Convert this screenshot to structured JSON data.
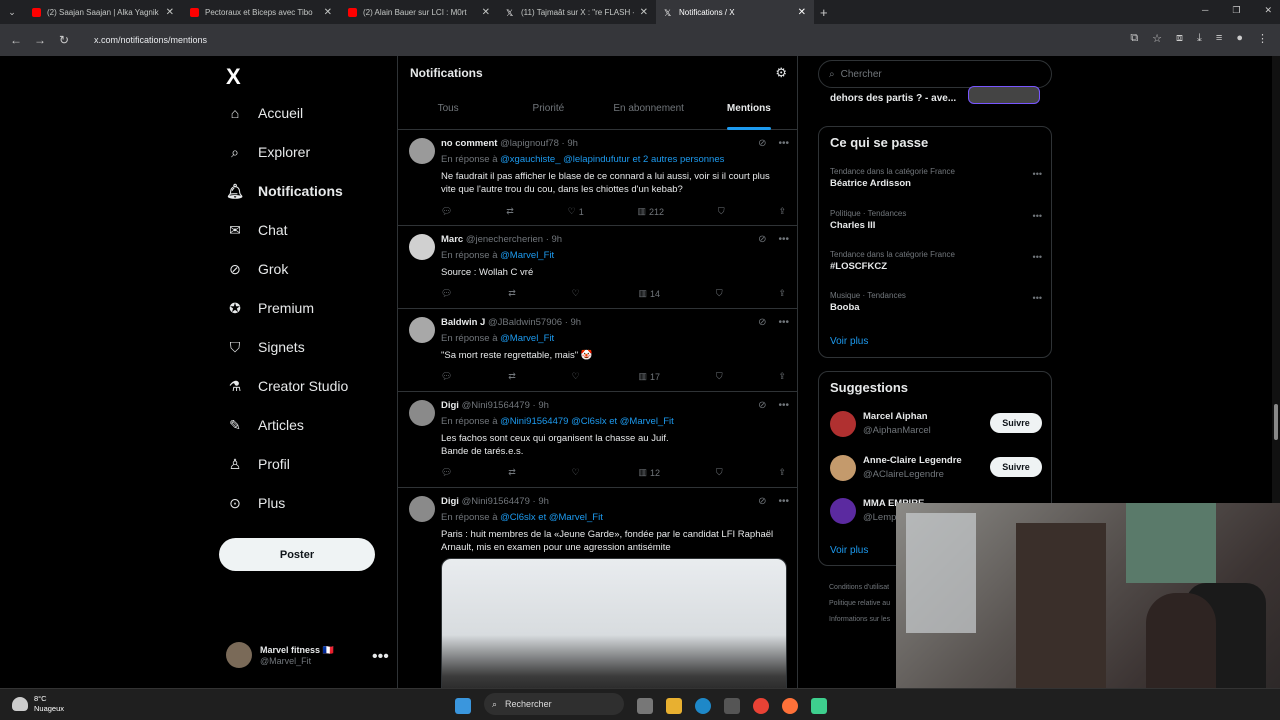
{
  "browser": {
    "tabs": [
      {
        "title": "(2) Saajan Saajan | Alka Yagnik",
        "color": "#ff0000"
      },
      {
        "title": "Pectoraux et Biceps avec Tibo",
        "color": "#ff0000"
      },
      {
        "title": "(2) Alain Bauer sur LCI : M0rt",
        "color": "#ff0000"
      },
      {
        "title": "(11) Tajmaât sur X : \"re FLASH -",
        "color": "#ffffff"
      },
      {
        "title": "Notifications / X",
        "color": "#ffffff",
        "active": true
      }
    ],
    "url": "x.com/notifications/mentions"
  },
  "sidebar": {
    "logo": "X",
    "items": [
      {
        "label": "Accueil",
        "icon": "home-icon"
      },
      {
        "label": "Explorer",
        "icon": "search-icon"
      },
      {
        "label": "Notifications",
        "icon": "bell-icon",
        "active": true
      },
      {
        "label": "Chat",
        "icon": "mail-icon"
      },
      {
        "label": "Grok",
        "icon": "grok-icon"
      },
      {
        "label": "Premium",
        "icon": "verified-icon"
      },
      {
        "label": "Signets",
        "icon": "bookmark-icon"
      },
      {
        "label": "Creator Studio",
        "icon": "flask-icon"
      },
      {
        "label": "Articles",
        "icon": "article-icon"
      },
      {
        "label": "Profil",
        "icon": "person-icon"
      },
      {
        "label": "Plus",
        "icon": "more-circle-icon"
      }
    ],
    "post_label": "Poster",
    "account": {
      "name": "Marvel fitness 🇫🇷",
      "handle": "@Marvel_Fit"
    }
  },
  "main": {
    "title": "Notifications",
    "tabs": [
      "Tous",
      "Priorité",
      "En abonnement",
      "Mentions"
    ],
    "selected_tab": "Mentions",
    "reply_prefix": "En réponse à",
    "tweets": [
      {
        "name": "no comment",
        "handle": "@lapignouf78",
        "time": "· 9h",
        "reply_to": "@xgauchiste_ @lelapindufutur  et 2 autres personnes",
        "text": "Ne faudrait il pas afficher le blase de ce connard a lui aussi, voir si il court plus vite que l'autre trou du cou, dans les chiottes d'un kebab?",
        "likes": "1",
        "views": "212"
      },
      {
        "name": "Marc",
        "handle": "@jenechercherien",
        "time": "· 9h",
        "reply_to": "@Marvel_Fit",
        "text": "Source : Wollah C vré",
        "likes": "",
        "views": "14"
      },
      {
        "name": "Baldwin J",
        "handle": "@JBaldwin57906",
        "time": "· 9h",
        "reply_to": "@Marvel_Fit",
        "text": "\"Sa mort reste regrettable, mais\" 🤡",
        "likes": "",
        "views": "17"
      },
      {
        "name": "Digi",
        "handle": "@Nini91564479",
        "time": "· 9h",
        "reply_to": "@Nini91564479 @Cl6slx  et  @Marvel_Fit",
        "text": "Les fachos sont ceux qui organisent la chasse au Juif.\nBande de tarés.e.s.",
        "likes": "",
        "views": "12"
      },
      {
        "name": "Digi",
        "handle": "@Nini91564479",
        "time": "· 9h",
        "reply_to": "@Cl6slx  et  @Marvel_Fit",
        "text": "Paris : huit membres de la «Jeune Garde», fondée par le candidat LFI Raphaël Arnault, mis en examen pour une agression antisémite",
        "likes": "",
        "views": ""
      }
    ]
  },
  "right": {
    "search_placeholder": "Chercher",
    "peek_text": "dehors des partis ? - ave...",
    "trends_title": "Ce qui se passe",
    "trends": [
      {
        "category": "Tendance dans la catégorie France",
        "name": "Béatrice Ardisson"
      },
      {
        "category": "Politique · Tendances",
        "name": "Charles III"
      },
      {
        "category": "Tendance dans la catégorie France",
        "name": "#LOSCFKCZ"
      },
      {
        "category": "Musique · Tendances",
        "name": "Booba"
      }
    ],
    "see_more": "Voir plus",
    "suggestions_title": "Suggestions",
    "suggestions": [
      {
        "name": "Marcel Aiphan",
        "handle": "@AiphanMarcel"
      },
      {
        "name": "Anne-Claire Legendre",
        "handle": "@AClaireLegendre"
      },
      {
        "name": "MMA EMPIRE",
        "handle": "@Lemp"
      }
    ],
    "follow_label": "Suivre",
    "footer": [
      "Conditions d'utilisat",
      "Politique relative au",
      "Informations sur les"
    ]
  },
  "taskbar": {
    "temp": "8°C",
    "weather": "Nuageux",
    "search": "Rechercher"
  }
}
